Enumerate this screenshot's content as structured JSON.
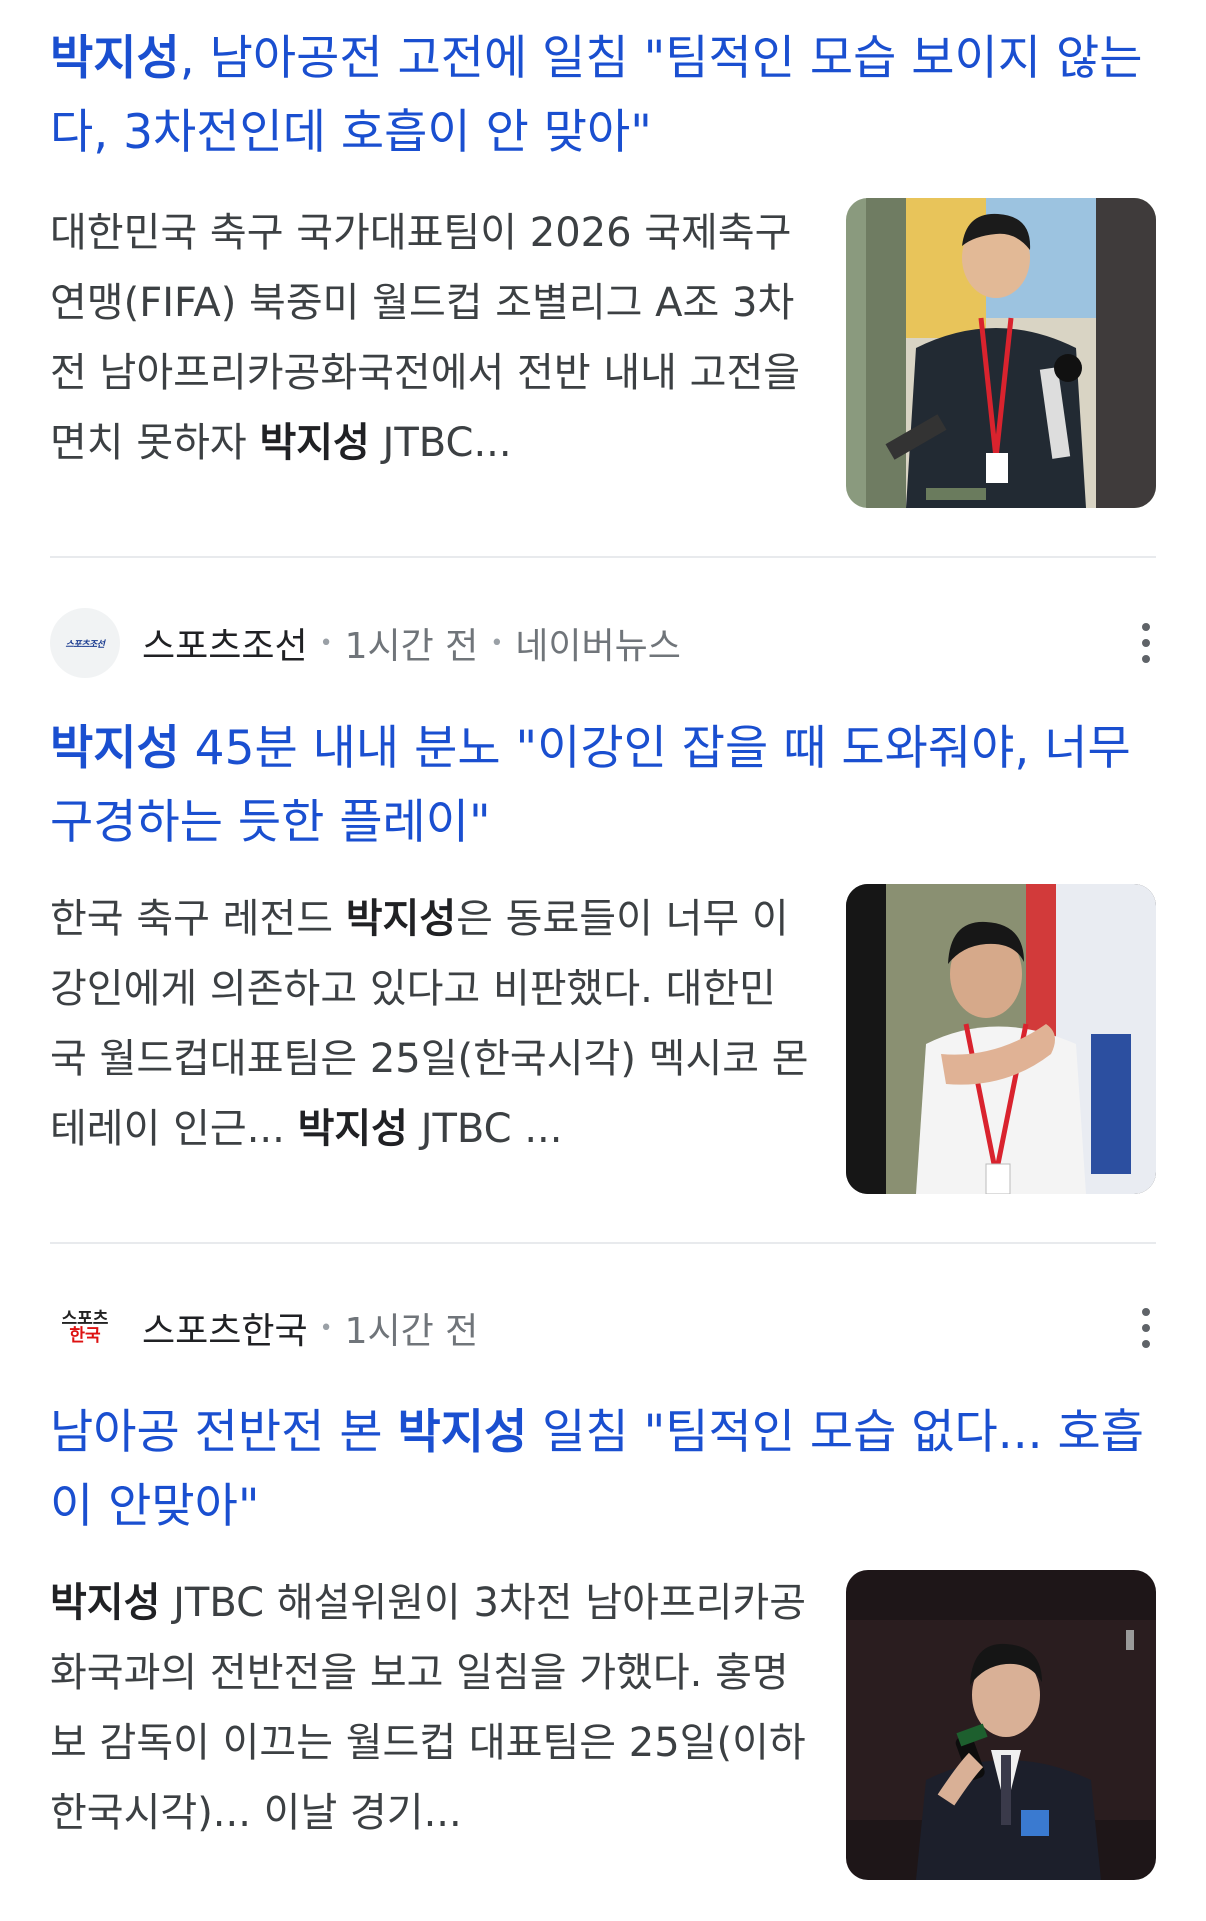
{
  "articles": [
    {
      "title_bold": "박지성",
      "title_rest": ", 남아공전 고전에 일침 \"팀적인 모습 보이지 않는다, 3차전인데 호흡이 안 맞아\"",
      "snippet_pre": "대한민국 축구 국가대표팀이 2026 국제축구연맹(FIFA) 북중미 월드컵 조별리그 A조 3차전 남아프리카공화국전에서 전반 내내 고전을 면치 못하자 ",
      "snippet_bold": "박지성",
      "snippet_post": " JTBC..."
    },
    {
      "source": "스포츠조선",
      "logo_text": "스포츠조선",
      "time": "1시간 전",
      "platform": "네이버뉴스",
      "title_bold": "박지성",
      "title_rest": " 45분 내내 분노 \"이강인 잡을 때 도와줘야, 너무 구경하는 듯한 플레이\"",
      "snippet_pre": "한국 축구 레전드 ",
      "snippet_bold": "박지성",
      "snippet_mid": "은 동료들이 너무 이강인에게 의존하고 있다고 비판했다. 대한민국 월드컵대표팀은 25일(한국시각) 멕시코 몬테레이 인근... ",
      "snippet_bold2": "박지성",
      "snippet_post": " JTBC ..."
    },
    {
      "source": "스포츠한국",
      "logo_line1": "스포츠",
      "logo_line2": "한국",
      "time": "1시간 전",
      "title_pre": "남아공 전반전 본 ",
      "title_bold": "박지성",
      "title_rest": " 일침 \"팀적인 모습 없다... 호흡이 안맞아\"",
      "snippet_bold": "박지성",
      "snippet_post": " JTBC 해설위원이 3차전 남아프리카공화국과의 전반전을 보고 일침을 가했다. 홍명보 감독이 이끄는 월드컵 대표팀은 25일(이하 한국시각)... 이날 경기..."
    }
  ],
  "colors": {
    "title": "#1a4fd0",
    "snippet": "#3c4043",
    "meta": "#70757a",
    "divider": "#e8eaed"
  },
  "icons": {
    "menu": "more-vert-icon"
  }
}
